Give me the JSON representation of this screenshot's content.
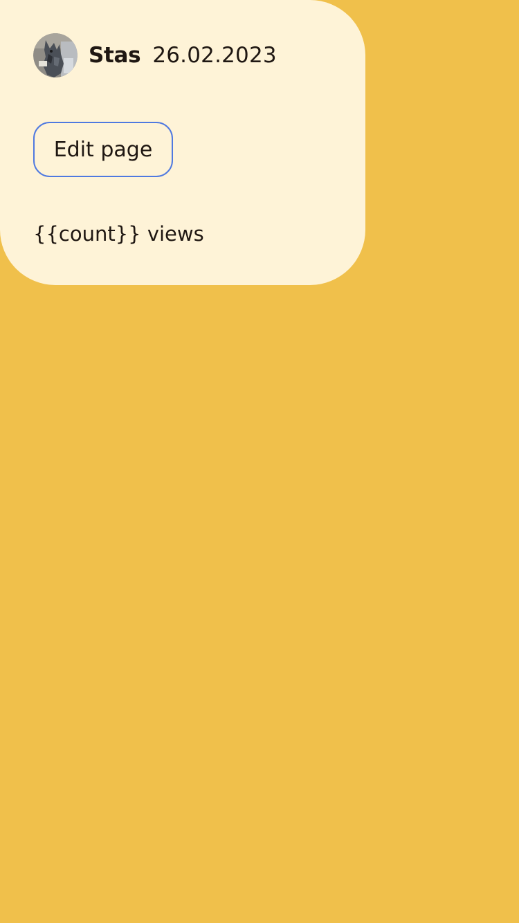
{
  "post": {
    "author": {
      "name": "Stas",
      "avatar": "dog-avatar"
    },
    "date": "26.02.2023",
    "edit_label": "Edit page",
    "views_text": "{{count}} views"
  },
  "colors": {
    "background": "#f0c04b",
    "card": "#fef3d7",
    "button_border": "#4f79e0",
    "text": "#1f1712"
  }
}
